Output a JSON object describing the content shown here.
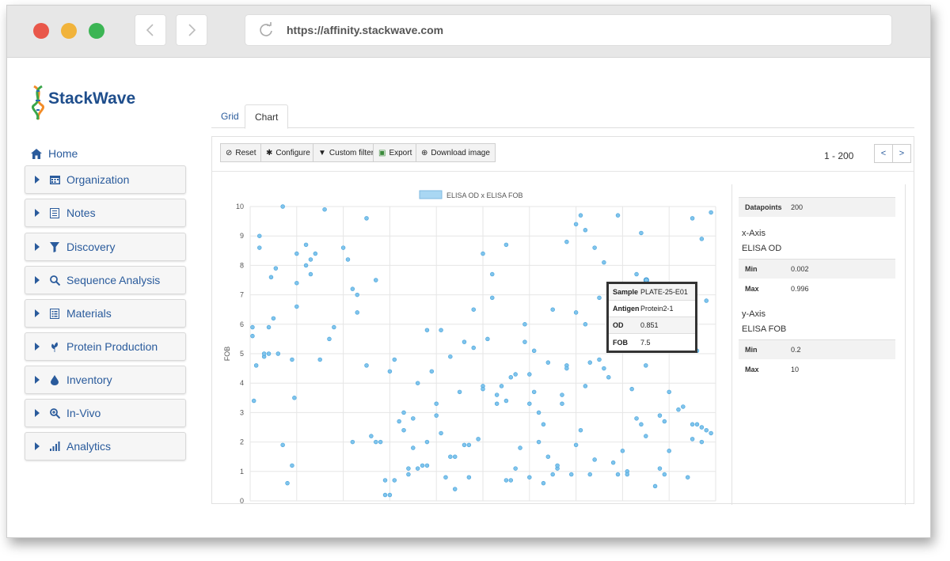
{
  "browser": {
    "url": "https://affinity.stackwave.com",
    "dot_colors": [
      "#e9574a",
      "#f1b33b",
      "#3cb554"
    ]
  },
  "app": {
    "logo_text": "StackWave",
    "home_label": "Home",
    "sidebar": [
      {
        "label": "Organization",
        "icon": "calendar-icon"
      },
      {
        "label": "Notes",
        "icon": "notes-icon"
      },
      {
        "label": "Discovery",
        "icon": "filter-icon"
      },
      {
        "label": "Sequence Analysis",
        "icon": "search-icon"
      },
      {
        "label": "Materials",
        "icon": "list-icon"
      },
      {
        "label": "Protein Production",
        "icon": "leaf-icon"
      },
      {
        "label": "Inventory",
        "icon": "drop-icon"
      },
      {
        "label": "In-Vivo",
        "icon": "zoom-icon"
      },
      {
        "label": "Analytics",
        "icon": "bars-icon"
      }
    ]
  },
  "tabs": [
    {
      "label": "Grid",
      "active": false
    },
    {
      "label": "Chart",
      "active": true
    }
  ],
  "toolbar": {
    "reset": "Reset",
    "configure": "Configure",
    "custom_filter": "Custom filter",
    "export": "Export",
    "download_image": "Download image",
    "range": "1 - 200",
    "prev": "<",
    "next": ">"
  },
  "stats": {
    "datapoints_label": "Datapoints",
    "datapoints": "200",
    "x_axis_heading": "x-Axis",
    "x_axis_name": "ELISA OD",
    "x_min_label": "Min",
    "x_min": "0.002",
    "x_max_label": "Max",
    "x_max": "0.996",
    "y_axis_heading": "y-Axis",
    "y_axis_name": "ELISA FOB",
    "y_min_label": "Min",
    "y_min": "0.2",
    "y_max_label": "Max",
    "y_max": "10"
  },
  "tooltip": {
    "rows": [
      {
        "k": "Sample",
        "v": "PLATE-25-E01"
      },
      {
        "k": "Antigen",
        "v": "Protein2-1"
      },
      {
        "k": "OD",
        "v": "0.851"
      },
      {
        "k": "FOB",
        "v": "7.5"
      }
    ]
  },
  "chart_data": {
    "type": "scatter",
    "title": "",
    "legend": "ELISA OD x ELISA FOB",
    "xlabel": "",
    "ylabel": "FOB",
    "ylim": [
      0,
      10
    ],
    "xlim": [
      0,
      1
    ],
    "yticks": [
      "0",
      "1",
      "2",
      "3",
      "4",
      "5",
      "6",
      "7",
      "8",
      "9",
      "10"
    ],
    "color": "#7fc4ec",
    "x": [
      0.005,
      0.005,
      0.008,
      0.013,
      0.02,
      0.03,
      0.03,
      0.04,
      0.05,
      0.045,
      0.07,
      0.055,
      0.06,
      0.1,
      0.1,
      0.1,
      0.08,
      0.09,
      0.095,
      0.12,
      0.13,
      0.14,
      0.13,
      0.16,
      0.17,
      0.2,
      0.21,
      0.23,
      0.22,
      0.23,
      0.25,
      0.27,
      0.29,
      0.3,
      0.31,
      0.33,
      0.35,
      0.38,
      0.4,
      0.41,
      0.45,
      0.46,
      0.48,
      0.5,
      0.52,
      0.53,
      0.55,
      0.57,
      0.6,
      0.65,
      0.68,
      0.7,
      0.71,
      0.72,
      0.75,
      0.78,
      0.8,
      0.84,
      0.85,
      0.9,
      0.92,
      0.95,
      0.97,
      0.99,
      0.32,
      0.33,
      0.34,
      0.37,
      0.38,
      0.39,
      0.41,
      0.43,
      0.44,
      0.47,
      0.49,
      0.51,
      0.54,
      0.56,
      0.58,
      0.59,
      0.6,
      0.61,
      0.62,
      0.63,
      0.65,
      0.66,
      0.67,
      0.7,
      0.72,
      0.73,
      0.75,
      0.76,
      0.78,
      0.79,
      0.8,
      0.82,
      0.83,
      0.85,
      0.86,
      0.88,
      0.89,
      0.91,
      0.93,
      0.95,
      0.96,
      0.98,
      0.02,
      0.04,
      0.07,
      0.09,
      0.12,
      0.15,
      0.18,
      0.22,
      0.26,
      0.28,
      0.35,
      0.36,
      0.42,
      0.44,
      0.48,
      0.5,
      0.52,
      0.55,
      0.57,
      0.62,
      0.64,
      0.66,
      0.68,
      0.69,
      0.71,
      0.74,
      0.77,
      0.81,
      0.84,
      0.87,
      0.9,
      0.94,
      0.97,
      0.99,
      0.3,
      0.31,
      0.36,
      0.4,
      0.46,
      0.5,
      0.55,
      0.59,
      0.61,
      0.64,
      0.67,
      0.7,
      0.73,
      0.76,
      0.79,
      0.83,
      0.86,
      0.89,
      0.92,
      0.95,
      0.97,
      0.98,
      0.25,
      0.27,
      0.29,
      0.34,
      0.38,
      0.43,
      0.47,
      0.53,
      0.56,
      0.6,
      0.63,
      0.68,
      0.72,
      0.74,
      0.81,
      0.88,
      0.93,
      0.96
    ],
    "y": [
      5.9,
      5.6,
      3.4,
      4.6,
      9.0,
      4.9,
      5.0,
      5.9,
      6.2,
      7.6,
      10.0,
      7.9,
      5.0,
      8.4,
      7.4,
      6.6,
      0.6,
      1.2,
      3.5,
      8.0,
      8.2,
      8.4,
      7.7,
      9.9,
      5.5,
      8.6,
      8.2,
      7.0,
      7.2,
      6.4,
      9.6,
      7.5,
      0.2,
      0.2,
      0.7,
      2.4,
      2.8,
      5.8,
      3.3,
      5.8,
      3.7,
      5.4,
      6.5,
      8.4,
      7.7,
      3.3,
      8.7,
      4.3,
      0.8,
      6.5,
      8.8,
      9.4,
      9.7,
      9.2,
      6.9,
      7.2,
      6.1,
      9.1,
      4.6,
      3.7,
      3.1,
      9.6,
      8.9,
      9.8,
      2.7,
      3.0,
      0.9,
      1.2,
      1.2,
      4.4,
      2.3,
      1.5,
      0.4,
      1.9,
      2.1,
      5.5,
      3.9,
      4.2,
      1.8,
      6.0,
      4.3,
      3.7,
      3.0,
      0.6,
      0.9,
      1.1,
      3.3,
      1.9,
      3.9,
      0.9,
      4.8,
      4.5,
      1.3,
      0.9,
      1.7,
      3.8,
      7.7,
      2.2,
      5.8,
      1.1,
      0.9,
      6.2,
      6.6,
      2.6,
      2.6,
      6.8,
      8.6,
      5.0,
      1.9,
      4.8,
      8.7,
      4.8,
      5.9,
      2.0,
      2.2,
      2.0,
      1.8,
      1.1,
      0.8,
      1.5,
      5.2,
      3.9,
      6.9,
      0.7,
      1.1,
      2.0,
      1.5,
      1.2,
      4.6,
      0.9,
      2.4,
      1.4,
      4.2,
      1.0,
      2.6,
      0.5,
      1.7,
      0.8,
      2.5,
      2.3,
      4.4,
      4.8,
      4.0,
      2.9,
      1.9,
      3.8,
      3.4,
      5.4,
      5.1,
      4.7,
      3.6,
      6.4,
      4.7,
      8.1,
      9.7,
      2.8,
      5.1,
      2.7,
      6.8,
      2.1,
      2.0,
      2.4,
      4.6,
      2.0,
      0.7,
      1.1,
      2.0,
      4.9,
      0.8,
      3.6,
      0.7,
      3.3,
      2.6,
      4.5,
      6.0,
      8.6,
      0.9,
      2.9,
      3.2,
      5.1,
      3.1,
      6.7,
      6.1,
      3.8,
      3.1,
      3.7,
      4.2,
      6.0,
      8.4,
      1.3,
      8.8,
      4.4,
      8.9,
      4.6,
      8.6,
      4.0,
      7.5,
      8.7,
      3.2,
      5.5
    ],
    "grid": true,
    "legend_position": "top-center"
  }
}
